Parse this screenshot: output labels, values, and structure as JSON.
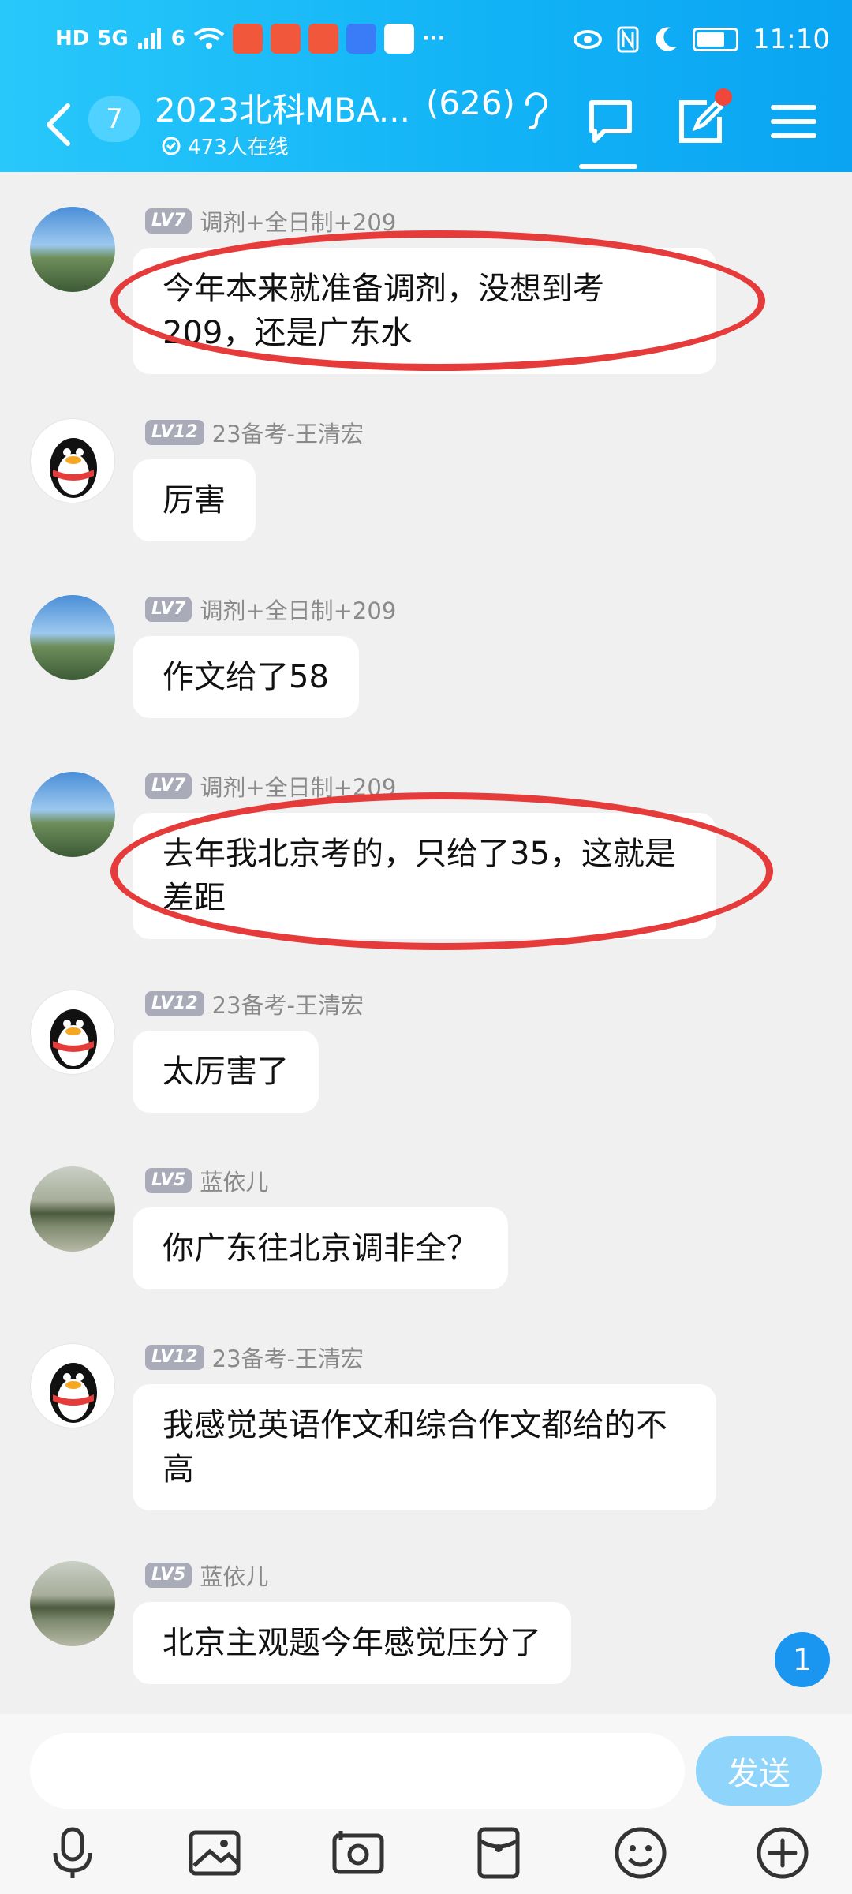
{
  "status_bar": {
    "network_label": "HD",
    "signal_label": "5G",
    "wifi_label": "6",
    "more": "···",
    "time": "11:10"
  },
  "header": {
    "unread_count": "7",
    "title": "2023北科MBA...",
    "member_count": "(626)",
    "online_text": "473人在线"
  },
  "messages": [
    {
      "level": "LV7",
      "nickname": "调剂+全日制+209",
      "text": "今年本来就准备调剂，没想到考209，还是广东水",
      "avatar": "landscape",
      "highlighted": true
    },
    {
      "level": "LV12",
      "nickname": "23备考-王清宏",
      "text": "厉害",
      "avatar": "qq-penguin",
      "highlighted": false
    },
    {
      "level": "LV7",
      "nickname": "调剂+全日制+209",
      "text": "作文给了58",
      "avatar": "landscape",
      "highlighted": false
    },
    {
      "level": "LV7",
      "nickname": "调剂+全日制+209",
      "text": "去年我北京考的，只给了35，这就是差距",
      "avatar": "landscape",
      "highlighted": true
    },
    {
      "level": "LV12",
      "nickname": "23备考-王清宏",
      "text": "太厉害了",
      "avatar": "qq-penguin",
      "highlighted": false
    },
    {
      "level": "LV5",
      "nickname": "蓝依儿",
      "text": "你广东往北京调非全？",
      "avatar": "lake",
      "highlighted": false
    },
    {
      "level": "LV12",
      "nickname": "23备考-王清宏",
      "text": "我感觉英语作文和综合作文都给的不高",
      "avatar": "qq-penguin",
      "highlighted": false
    },
    {
      "level": "LV5",
      "nickname": "蓝依儿",
      "text": "北京主观题今年感觉压分了",
      "avatar": "lake",
      "highlighted": false
    }
  ],
  "scroll_badge": "1",
  "input": {
    "placeholder": "",
    "send_label": "发送"
  },
  "colors": {
    "header_start": "#28c8fb",
    "header_end": "#0aa4f2",
    "annotation_red": "#e53b3b",
    "send_button": "#8fd4fb"
  }
}
